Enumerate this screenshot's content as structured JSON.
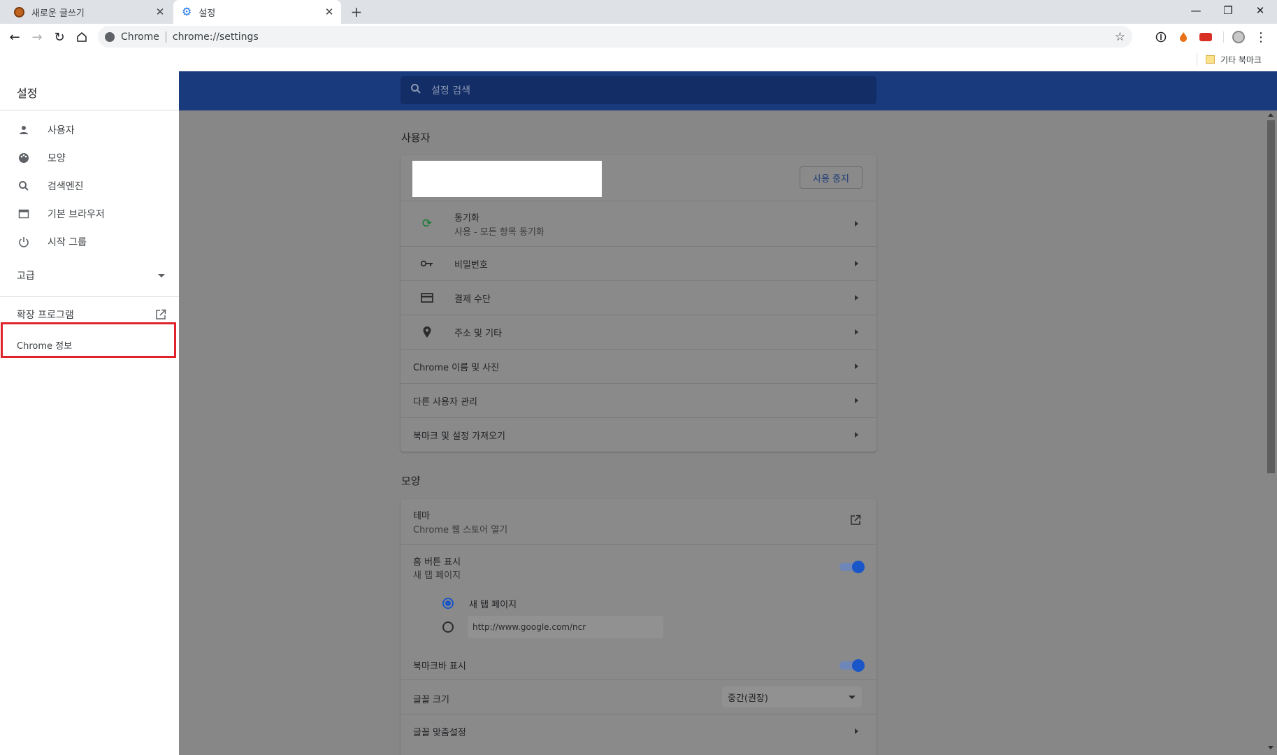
{
  "tabs": [
    {
      "title": "새로운 글쓰기"
    },
    {
      "title": "설정"
    }
  ],
  "omnibox": {
    "site_label": "Chrome",
    "url": "chrome://settings"
  },
  "bookmarks_bar": {
    "other_bookmarks": "기타 북마크"
  },
  "settings_title": "설정",
  "search": {
    "placeholder": "설정 검색"
  },
  "sidebar": {
    "items": [
      {
        "label": "사용자",
        "icon": "person-icon"
      },
      {
        "label": "모양",
        "icon": "palette-icon"
      },
      {
        "label": "검색엔진",
        "icon": "search-icon"
      },
      {
        "label": "기본 브라우저",
        "icon": "browser-icon"
      },
      {
        "label": "시작 그룹",
        "icon": "power-icon"
      }
    ],
    "advanced": "고급",
    "extensions": "확장 프로그램",
    "about": "Chrome 정보"
  },
  "people": {
    "section_title": "사용자",
    "stop_button": "사용 중지",
    "sync": {
      "title": "동기화",
      "subtitle": "사용 - 모든 항목 동기화"
    },
    "passwords": "비밀번호",
    "payment": "결제 수단",
    "addresses": "주소 및 기타",
    "chrome_name": "Chrome 이름 및 사진",
    "manage_users": "다른 사용자 관리",
    "import": "북마크 및 설정 가져오기"
  },
  "appearance": {
    "section_title": "모양",
    "theme": {
      "title": "테마",
      "subtitle": "Chrome 웹 스토어 열기"
    },
    "home_button": {
      "title": "홈 버튼 표시",
      "subtitle": "새 탭 페이지",
      "enabled": true
    },
    "radio_new_tab": "새 탭 페이지",
    "custom_url": "http://www.google.com/ncr",
    "bookmarks_bar": {
      "title": "북마크바 표시",
      "enabled": true
    },
    "font_size": {
      "title": "글꼴 크기",
      "value": "중간(권장)"
    },
    "customize_fonts": "글꼴 맞춤설정"
  },
  "colors": {
    "highlight": "#e0242b",
    "header": "#1a3a7e",
    "accent": "#1a56c7"
  }
}
